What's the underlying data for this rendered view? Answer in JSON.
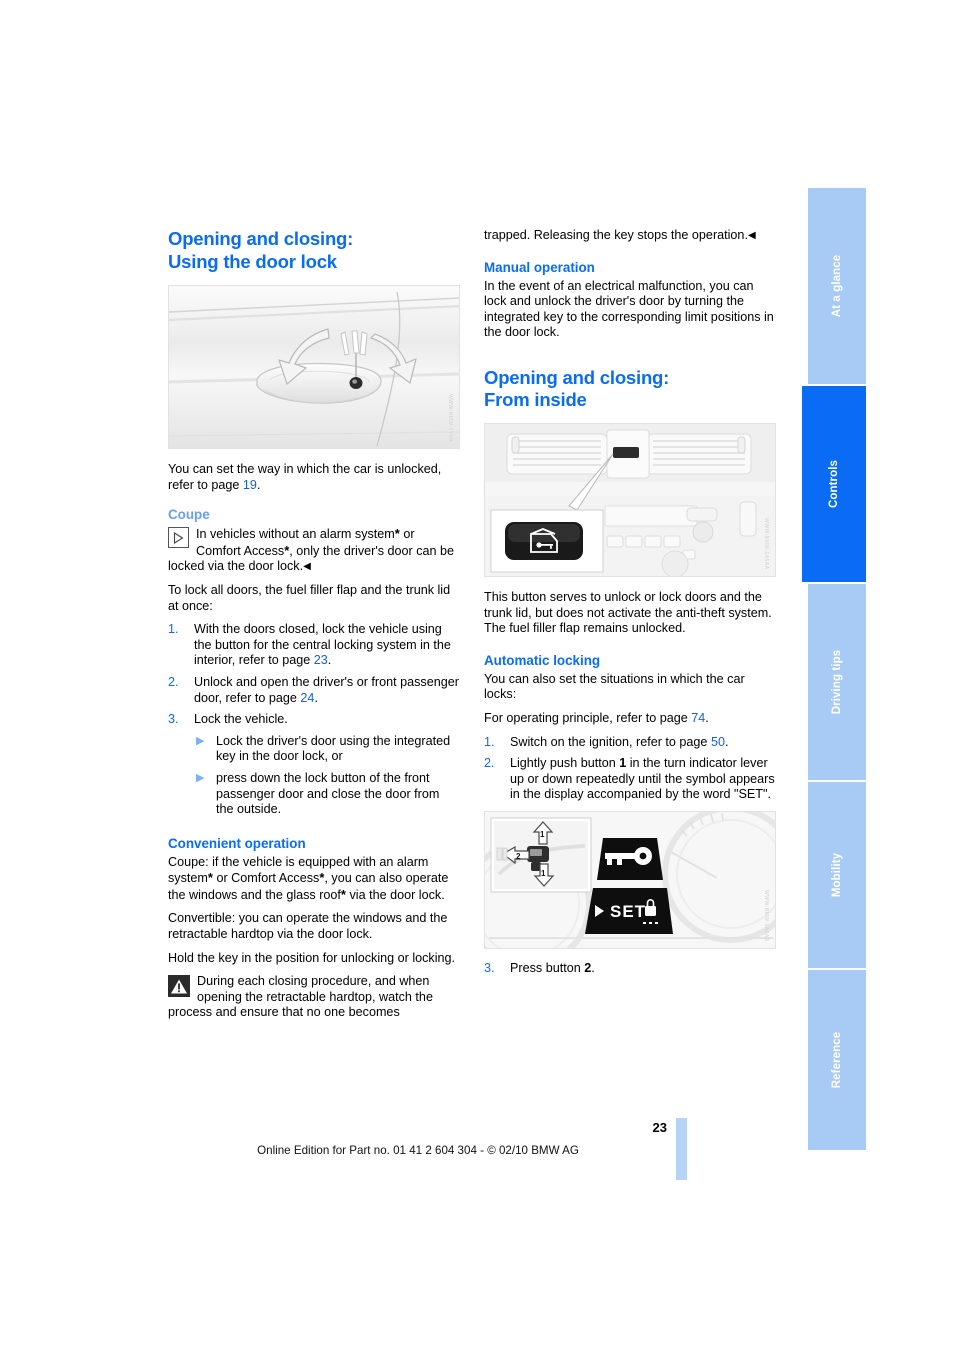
{
  "page": {
    "number": "23",
    "footer_text": "Online Edition for Part no. 01 41 2 604 304 - © 02/10 BMW AG",
    "accent_blue": "#0a6cf5",
    "tab_blue": "#a8cbf5",
    "link_blue": "#1a5fd6"
  },
  "tabs": [
    {
      "label": "At a glance",
      "active": false
    },
    {
      "label": "Controls",
      "active": true
    },
    {
      "label": "Driving tips",
      "active": false
    },
    {
      "label": "Mobility",
      "active": false
    },
    {
      "label": "Reference",
      "active": false
    }
  ],
  "left_column": {
    "heading_line1": "Opening and closing:",
    "heading_line2": "Using the door lock",
    "figure1": {
      "name": "door-handle-lock-illustration",
      "caption_alt": "Exterior door handle with integrated key lock and rotation arrows"
    },
    "intro": {
      "text_before": "You can set the way in which the car is unlocked, refer to page ",
      "page_ref": "19",
      "text_after": "."
    },
    "coupe": {
      "heading": "Coupe",
      "note_text_1": "In vehicles without an alarm system",
      "note_text_2": " or Comfort Access",
      "note_text_3": ", only the driver's door can be locked via the door lock.",
      "star": "*",
      "endmark": "◀",
      "paragraph": "To lock all doors, the fuel filler flap and the trunk lid at once:",
      "steps": [
        {
          "num": "1.",
          "text_before": "With the doors closed, lock the vehicle using the button for the central locking system in the interior, refer to page ",
          "page_ref": "23",
          "text_after": "."
        },
        {
          "num": "2.",
          "text_before": "Unlock and open the driver's or front passenger door, refer to page ",
          "page_ref": "24",
          "text_after": "."
        },
        {
          "num": "3.",
          "text_before": "Lock the vehicle.",
          "page_ref": "",
          "text_after": "",
          "subitems": [
            "Lock the driver's door using the integrated key in the door lock, or",
            "press down the lock button of the front passenger door and close the door from the outside."
          ]
        }
      ]
    },
    "convenient": {
      "heading": "Convenient operation",
      "para1_a": "Coupe: if the vehicle is equipped with an alarm system",
      "para1_b": " or Comfort Access",
      "para1_c": ", you can also operate the windows and the glass roof",
      "para1_d": " via the door lock.",
      "para2": "Convertible: you can operate the windows and the retractable hardtop via the door lock.",
      "para3": "Hold the key in the position for unlocking or locking.",
      "warning": "During each closing procedure, and when opening the retractable hardtop, watch the process and ensure that no one becomes"
    }
  },
  "right_column": {
    "continuation": "trapped. Releasing the key stops the operation.",
    "continuation_endmark": "◀",
    "manual": {
      "heading": "Manual operation",
      "paragraph": "In the event of an electrical malfunction, you can lock and unlock the driver's door by turning the integrated key to the corresponding limit positions in the door lock."
    },
    "heading_line1": "Opening and closing:",
    "heading_line2": "From inside",
    "figure2": {
      "name": "central-locking-button-illustration",
      "caption_alt": "Dashboard centre console with central locking button detail"
    },
    "button_paragraph": "This button serves to unlock or lock doors and the trunk lid, but does not activate the anti-theft system. The fuel filler flap remains unlocked.",
    "automatic": {
      "heading": "Automatic locking",
      "para1": "You can also set the situations in which the car locks:",
      "para2_before": "For operating principle, refer to page ",
      "para2_ref": "74",
      "para2_after": ".",
      "steps": [
        {
          "num": "1.",
          "text_before": "Switch on the ignition, refer to page ",
          "page_ref": "50",
          "text_after": "."
        },
        {
          "num": "2.",
          "text_before": "Lightly push button ",
          "bold": "1",
          "text_after": " in the turn indicator lever up or down repeatedly until the symbol appears in the display accompanied by the word \"SET\"."
        }
      ],
      "figure3": {
        "name": "instrument-cluster-set-illustration",
        "caption_alt": "Instrument cluster display showing key symbol, SET and lock symbol; inset of indicator lever buttons 1 and 2",
        "display_set_text": "SET",
        "inset_label_1": "1",
        "inset_label_2": "2"
      },
      "step3": {
        "num": "3.",
        "text_before": "Press button ",
        "bold": "2",
        "text_after": "."
      }
    }
  }
}
